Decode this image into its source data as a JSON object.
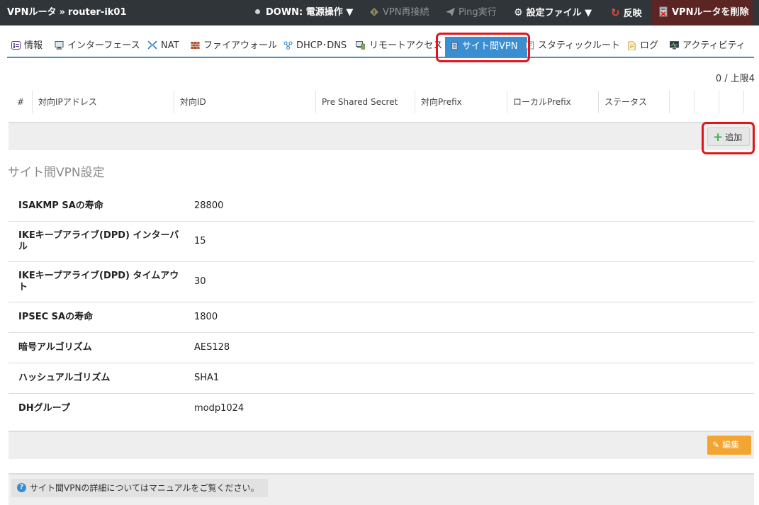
{
  "topbar": {
    "breadcrumb_root": "VPNルータ",
    "breadcrumb_sep": "»",
    "breadcrumb_current": "router-ik01",
    "status_label": "DOWN: 電源操作",
    "reconnect_label": "VPN再接続",
    "ping_label": "Ping実行",
    "config_label": "設定ファイル",
    "apply_label": "反映",
    "delete_label": "VPNルータを削除",
    "dropdown_glyph": "▼"
  },
  "tabs": [
    {
      "label": "情報",
      "icon": "info-icon"
    },
    {
      "label": "インターフェース",
      "icon": "monitor-icon"
    },
    {
      "label": "NAT",
      "icon": "nat-arrows-icon"
    },
    {
      "label": "ファイアウォール",
      "icon": "firewall-icon"
    },
    {
      "label": "DHCP･DNS",
      "icon": "network-nodes-icon"
    },
    {
      "label": "リモートアクセス",
      "icon": "remote-pc-icon"
    },
    {
      "label": "サイト間VPN",
      "icon": "vpn-router-icon",
      "active": true
    },
    {
      "label": "スタティックルート",
      "icon": "route-icon"
    },
    {
      "label": "ログ",
      "icon": "log-file-icon"
    },
    {
      "label": "アクティビティ",
      "icon": "activity-monitor-icon"
    }
  ],
  "table": {
    "count": "0 / 上限4",
    "columns": [
      "#",
      "対向IPアドレス",
      "対向ID",
      "Pre Shared Secret",
      "対向Prefix",
      "ローカルPrefix",
      "ステータス"
    ],
    "add_label": "追加"
  },
  "settings": {
    "title": "サイト間VPN設定",
    "rows": [
      {
        "label": "ISAKMP SAの寿命",
        "value": "28800"
      },
      {
        "label": "IKEキープアライブ(DPD) インターバル",
        "value": "15"
      },
      {
        "label": "IKEキープアライブ(DPD) タイムアウト",
        "value": "30"
      },
      {
        "label": "IPSEC SAの寿命",
        "value": "1800"
      },
      {
        "label": "暗号アルゴリズム",
        "value": "AES128"
      },
      {
        "label": "ハッシュアルゴリズム",
        "value": "SHA1"
      },
      {
        "label": "DHグループ",
        "value": "modp1024"
      }
    ],
    "edit_label": "編集"
  },
  "footer": {
    "help_text": "サイト間VPNの詳細についてはマニュアルをご覧ください。"
  },
  "colors": {
    "topbar_bg": "#2f3539",
    "delete_bg": "#5b2524",
    "accent": "#3a8fd3",
    "highlight": "#e3131b",
    "edit_button": "#f3a532",
    "add_plus": "#3db649"
  }
}
